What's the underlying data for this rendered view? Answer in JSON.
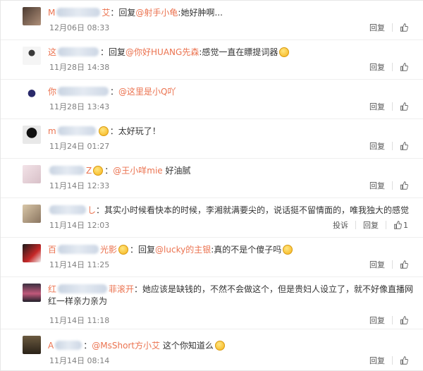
{
  "comments": [
    {
      "name_start": "M",
      "name_end": "艾",
      "text_parts": [
        "：回复",
        "@射手小龟",
        ":她好肿啊..."
      ],
      "time": "12月06日 08:33",
      "reply": "回复"
    },
    {
      "name_start": "这",
      "name_end": "",
      "text_parts": [
        "：回复",
        "@你好HUANG先森",
        ":感觉一直在瞟提词器"
      ],
      "time": "11月28日 14:38",
      "reply": "回复"
    },
    {
      "name_start": "你",
      "name_end": "",
      "text_parts": [
        "：",
        "@这里是小Q吖",
        ""
      ],
      "time": "11月28日 13:43",
      "reply": "回复"
    },
    {
      "name_start": "m",
      "name_end": "",
      "text_parts": [
        "：太好玩了！"
      ],
      "time": "11月24日 01:27",
      "reply": "回复"
    },
    {
      "name_start": "",
      "name_end": "Z",
      "text_parts": [
        "：",
        "@王小咩mie",
        " 好油腻"
      ],
      "time": "11月14日 12:33",
      "reply": "回复"
    },
    {
      "name_start": "",
      "name_end": "し",
      "text_parts": [
        "：其实小时候看快本的时候，李湘就满要尖的，说话挺不留情面的，唯我独大的感觉"
      ],
      "time": "11月14日 12:03",
      "report": "投诉",
      "reply": "回复",
      "likes": "1"
    },
    {
      "name_start": "百",
      "name_end": "光影",
      "text_parts": [
        "：回复",
        "@lucky的主银",
        ":真的不是个傻子吗"
      ],
      "time": "11月14日 11:25",
      "reply": "回复"
    },
    {
      "name_start": "红",
      "name_end": "菲滚开",
      "text_parts": [
        "：她应该是缺钱的，不然不会做这个，但是贵妇人设立了，就不好像直播网红一样亲力亲为"
      ],
      "time": "11月14日 11:18",
      "reply": "回复"
    },
    {
      "name_start": "A",
      "name_end": "",
      "text_parts": [
        "：",
        "@MsShort方小艾",
        " 这个你知道么"
      ],
      "time": "11月14日 08:14",
      "reply": "回复"
    }
  ],
  "colors": {
    "accent": "#eb7350",
    "name_blur": "#c9d4e2"
  },
  "icons": {
    "like": "thumbs-up-icon",
    "emoji": "smiley-emoji-icon"
  }
}
